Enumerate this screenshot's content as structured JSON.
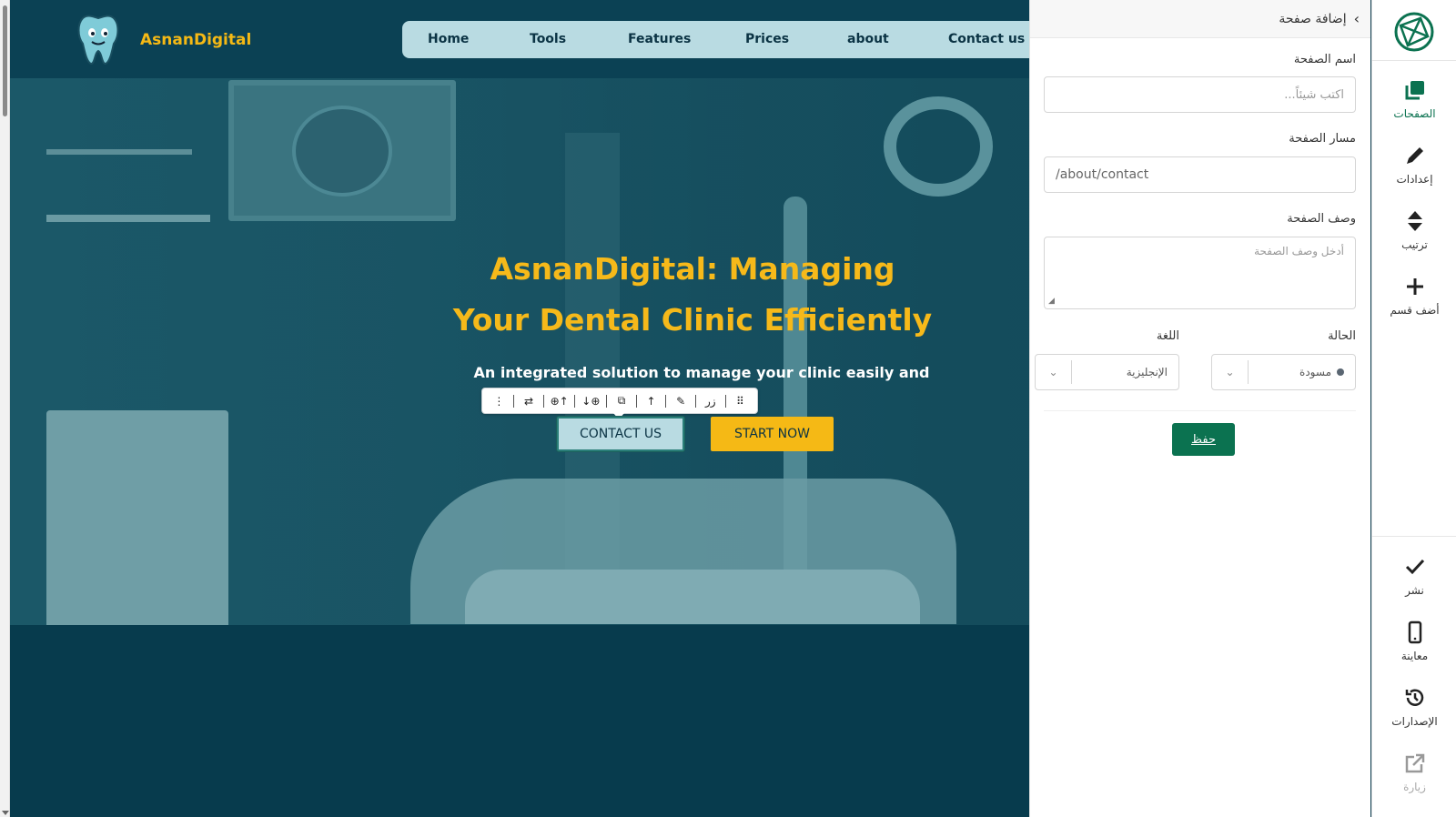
{
  "site": {
    "brand": "AsnanDigital",
    "nav": [
      "Home",
      "Tools",
      "Features",
      "Prices",
      "about",
      "Contact us"
    ],
    "hero_title_line1": "AsnanDigital: Managing",
    "hero_title_line2": "Your Dental Clinic Efficiently",
    "hero_subtitle": "An integrated solution to manage your clinic easily and",
    "contact_button": "CONTACT US",
    "start_button": "START NOW",
    "colors": {
      "brand_yellow": "#f5b915",
      "header_bg": "#0b4154",
      "nav_bg": "#b9dbe2"
    }
  },
  "toolbar": {
    "items": [
      {
        "icon": "more-vertical-icon",
        "glyph": "⋮"
      },
      {
        "icon": "swap-icon",
        "glyph": "⇄"
      },
      {
        "icon": "add-above-icon",
        "glyph": "⊕↑"
      },
      {
        "icon": "add-below-icon",
        "glyph": "↓⊕"
      },
      {
        "icon": "copy-icon",
        "glyph": "⧉"
      },
      {
        "icon": "arrow-up-icon",
        "glyph": "↑"
      },
      {
        "icon": "pencil-icon",
        "glyph": "✎"
      },
      {
        "icon": "element-type",
        "glyph": "زر"
      },
      {
        "icon": "drag-handle-icon",
        "glyph": "⠿"
      }
    ]
  },
  "panel": {
    "title": "إضافة صفحة",
    "page_name_label": "اسم الصفحة",
    "page_name_placeholder": "اكتب شيئاً...",
    "page_path_label": "مسار الصفحة",
    "page_path_value": "/about/contact",
    "page_desc_label": "وصف الصفحة",
    "page_desc_placeholder": "أدخل وصف الصفحة",
    "status_label": "الحالة",
    "status_value": "مسودة",
    "language_label": "اللغة",
    "language_value": "الإنجليزية",
    "save": "حفظ",
    "accent": "#0b7250"
  },
  "rail": {
    "top": [
      {
        "label": "الصفحات",
        "icon": "pages-icon",
        "active": true
      },
      {
        "label": "إعدادات",
        "icon": "pencil-icon",
        "active": false
      },
      {
        "label": "ترتيب",
        "icon": "sort-icon",
        "active": false
      },
      {
        "label": "أضف قسم",
        "icon": "plus-icon",
        "active": false
      }
    ],
    "bottom": [
      {
        "label": "نشر",
        "icon": "check-icon"
      },
      {
        "label": "معاينة",
        "icon": "mobile-icon"
      },
      {
        "label": "الإصدارات",
        "icon": "history-icon"
      },
      {
        "label": "زيارة",
        "icon": "external-link-icon"
      }
    ]
  }
}
